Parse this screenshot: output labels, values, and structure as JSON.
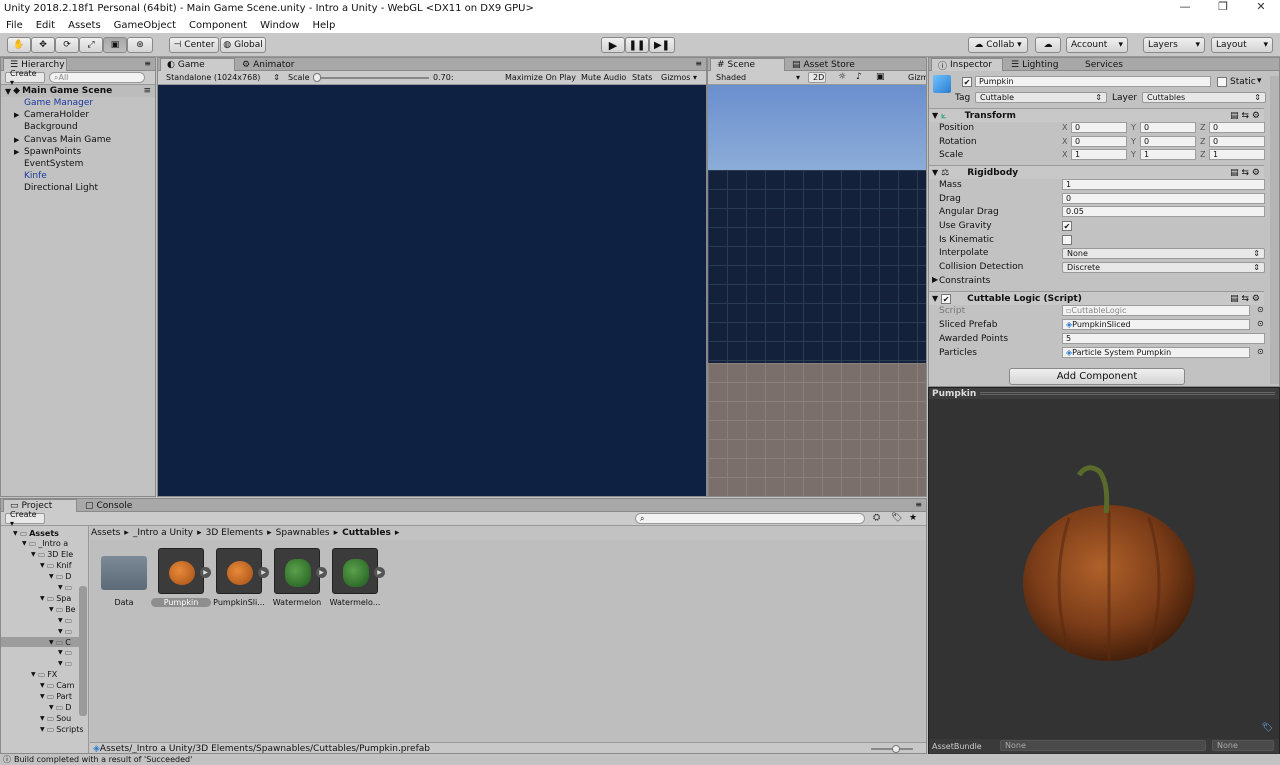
{
  "window": {
    "title": "Unity 2018.2.18f1 Personal (64bit) - Main Game Scene.unity - Intro a Unity - WebGL <DX11 on DX9 GPU>",
    "controls": [
      "—",
      "❐",
      "✕"
    ]
  },
  "menu": [
    "File",
    "Edit",
    "Assets",
    "GameObject",
    "Component",
    "Window",
    "Help"
  ],
  "toolbar": {
    "center_label": "Center",
    "global_label": "Global",
    "collab_label": "Collab ▾",
    "account_label": "Account",
    "layers_label": "Layers",
    "layout_label": "Layout"
  },
  "hierarchy": {
    "tab": "Hierarchy",
    "create_label": "Create ▾",
    "search_placeholder": "All",
    "scene_name": "Main Game Scene",
    "items": [
      {
        "label": "Game Manager",
        "blue": true,
        "expand": false
      },
      {
        "label": "CameraHolder",
        "blue": false,
        "expand": true
      },
      {
        "label": "Background",
        "blue": false,
        "expand": false
      },
      {
        "label": "Canvas Main Game",
        "blue": false,
        "expand": true
      },
      {
        "label": "SpawnPoints",
        "blue": false,
        "expand": true
      },
      {
        "label": "EventSystem",
        "blue": false,
        "expand": false
      },
      {
        "label": "Kinfe",
        "blue": true,
        "expand": false
      },
      {
        "label": "Directional Light",
        "blue": false,
        "expand": false
      }
    ]
  },
  "game_view": {
    "tabs": [
      "Game",
      "Animator"
    ],
    "resolution": "Standalone (1024x768)",
    "scale_label": "Scale",
    "scale_value": "0.70:",
    "buttons": [
      "Maximize On Play",
      "Mute Audio",
      "Stats",
      "Gizmos ▾"
    ],
    "background_color": "#0e2143"
  },
  "scene_view": {
    "tabs": [
      "Scene",
      "Asset Store"
    ],
    "shading": "Shaded",
    "mode_2d": "2D",
    "gizmos_label": "Gizm"
  },
  "inspector": {
    "tabs": [
      "Inspector",
      "Lighting",
      "Services"
    ],
    "object_name": "Pumpkin",
    "static_label": "Static",
    "tag_label": "Tag",
    "tag_value": "Cuttable",
    "layer_label": "Layer",
    "layer_value": "Cuttables",
    "transform": {
      "title": "Transform",
      "rows": [
        {
          "label": "Position",
          "x": "0",
          "y": "0",
          "z": "0"
        },
        {
          "label": "Rotation",
          "x": "0",
          "y": "0",
          "z": "0"
        },
        {
          "label": "Scale",
          "x": "1",
          "y": "1",
          "z": "1"
        }
      ]
    },
    "rigidbody": {
      "title": "Rigidbody",
      "mass_label": "Mass",
      "mass": "1",
      "drag_label": "Drag",
      "drag": "0",
      "angular_drag_label": "Angular Drag",
      "angular_drag": "0.05",
      "use_gravity_label": "Use Gravity",
      "use_gravity": "✔",
      "is_kinematic_label": "Is Kinematic",
      "interpolate_label": "Interpolate",
      "interpolate": "None",
      "collision_label": "Collision Detection",
      "collision": "Discrete",
      "constraints_label": "Constraints"
    },
    "cuttable": {
      "title": "Cuttable Logic (Script)",
      "script_label": "Script",
      "script": "CuttableLogic",
      "sliced_label": "Sliced Prefab",
      "sliced": "PumpkinSliced",
      "points_label": "Awarded Points",
      "points": "5",
      "particles_label": "Particles",
      "particles": "Particle System Pumpkin"
    },
    "add_component": "Add Component",
    "preview_title": "Pumpkin",
    "assetbundle_label": "AssetBundle",
    "assetbundle_value": "None",
    "assetbundle_variant": "None"
  },
  "project": {
    "tabs": [
      "Project",
      "Console"
    ],
    "create_label": "Create ▾",
    "breadcrumb": [
      "Assets",
      "_Intro a Unity",
      "3D Elements",
      "Spawnables",
      "Cuttables"
    ],
    "tree": [
      {
        "label": "Assets",
        "indent": 0
      },
      {
        "label": "_Intro a",
        "indent": 1
      },
      {
        "label": "3D Ele",
        "indent": 2
      },
      {
        "label": "Knif",
        "indent": 3
      },
      {
        "label": "D",
        "indent": 4
      },
      {
        "label": "",
        "indent": 5
      },
      {
        "label": "Spa",
        "indent": 3
      },
      {
        "label": "Be",
        "indent": 4
      },
      {
        "label": "",
        "indent": 5
      },
      {
        "label": "",
        "indent": 5
      },
      {
        "label": "C",
        "indent": 4
      },
      {
        "label": "",
        "indent": 5
      },
      {
        "label": "",
        "indent": 5
      },
      {
        "label": "FX",
        "indent": 2
      },
      {
        "label": "Cam",
        "indent": 3
      },
      {
        "label": "Part",
        "indent": 3
      },
      {
        "label": "D",
        "indent": 4
      },
      {
        "label": "Sou",
        "indent": 3
      },
      {
        "label": "Scripts",
        "indent": 3
      }
    ],
    "assets": [
      {
        "label": "Data",
        "kind": "folder"
      },
      {
        "label": "Pumpkin",
        "kind": "pumpkin",
        "selected": true
      },
      {
        "label": "PumpkinSli...",
        "kind": "pumpkin"
      },
      {
        "label": "Watermelon",
        "kind": "melon"
      },
      {
        "label": "Watermelo...",
        "kind": "melon"
      }
    ],
    "path": "Assets/_Intro a Unity/3D Elements/Spawnables/Cuttables/Pumpkin.prefab"
  },
  "status": "Build completed with a result of 'Succeeded'"
}
